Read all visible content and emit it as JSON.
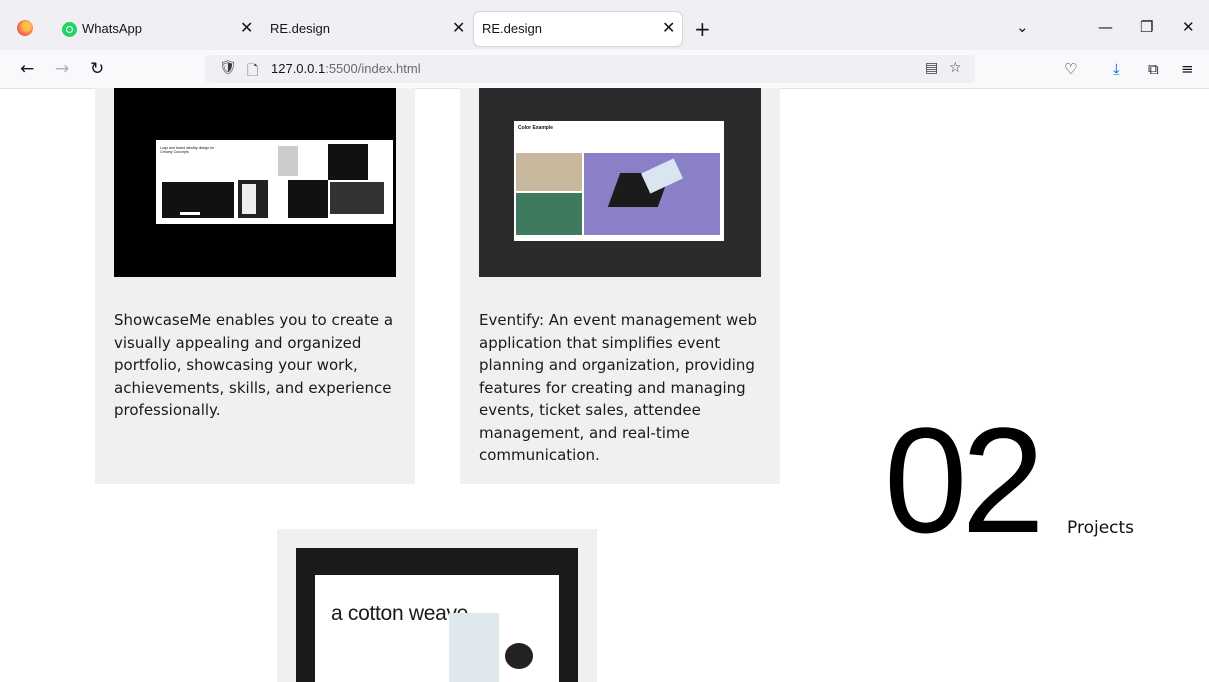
{
  "browser": {
    "tabs": [
      {
        "label": "WhatsApp",
        "active": false,
        "icon": "whatsapp-icon"
      },
      {
        "label": "RE.design",
        "active": false
      },
      {
        "label": "RE.design",
        "active": true
      }
    ],
    "new_tab": "+",
    "url_host": "127.0.0.1",
    "url_path": ":5500/index.html",
    "accent": "#0060df"
  },
  "projects": {
    "cards": [
      {
        "description": "ShowcaseMe enables you to create a visually appealing and organized portfolio, showcasing your work, achievements, skills, and experience professionally.",
        "mockup_title": "Logo and brand identity design for Creamy Concepts"
      },
      {
        "description": "Eventify: An event management web application that simplifies event planning and organization, providing features for creating and managing events, ticket sales, attendee management, and real-time communication.",
        "mockup_title": "Color Example"
      },
      {
        "mockup_title": "a cotton weave."
      }
    ],
    "count": "02",
    "count_label": "Projects"
  }
}
